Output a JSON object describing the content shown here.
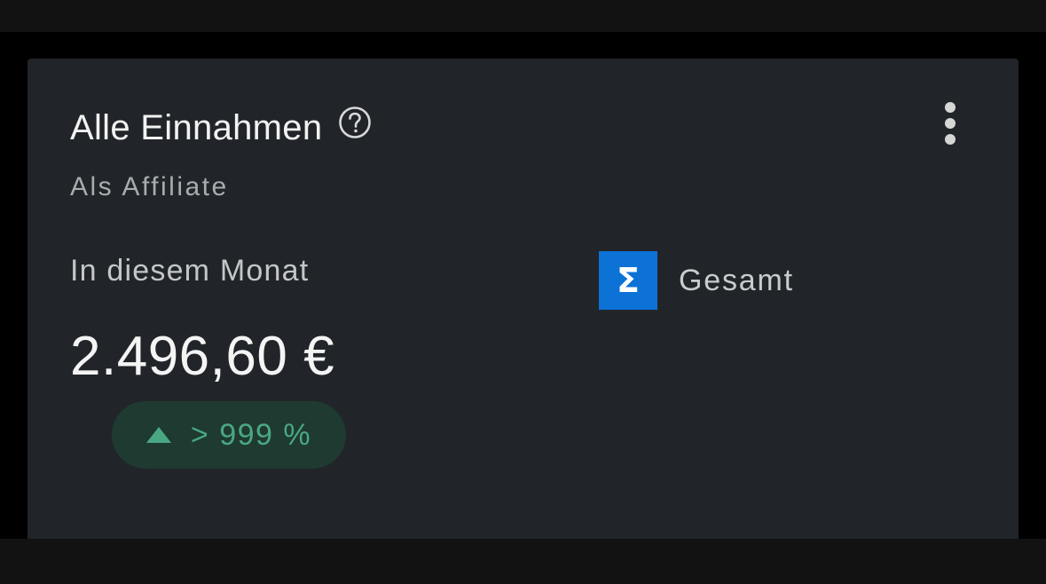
{
  "card": {
    "title": "Alle Einnahmen",
    "subtitle": "Als Affiliate",
    "period_label": "In diesem Monat",
    "amount": "2.496,60 €",
    "change": {
      "text": "> 999 %",
      "direction": "up"
    },
    "scope": {
      "icon": "sigma-icon",
      "label": "Gesamt"
    },
    "icons": {
      "help": "help-circle-icon",
      "menu": "more-vertical-icon"
    }
  },
  "colors": {
    "card_bg": "#212529",
    "accent_blue": "#0d72d6",
    "positive_green": "#4aa784",
    "positive_badge_bg": "#1f3a30"
  }
}
